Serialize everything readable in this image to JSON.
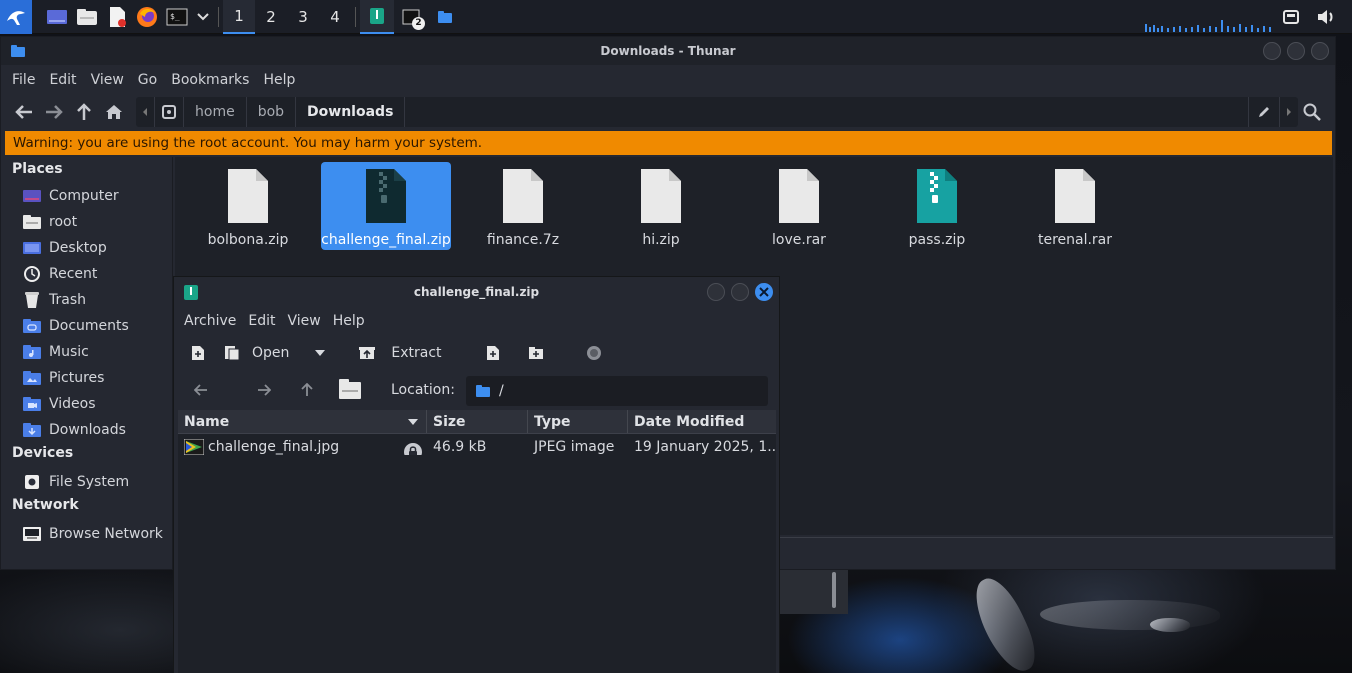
{
  "panel": {
    "workspaces": [
      "1",
      "2",
      "3",
      "4"
    ],
    "terminal_badge": "2"
  },
  "thunar": {
    "title": "Downloads - Thunar",
    "menu": [
      "File",
      "Edit",
      "View",
      "Go",
      "Bookmarks",
      "Help"
    ],
    "path": [
      "home",
      "bob",
      "Downloads"
    ],
    "warning": "Warning: you are using the root account. You may harm your system.",
    "sidebar": {
      "places_label": "Places",
      "places": [
        "Computer",
        "root",
        "Desktop",
        "Recent",
        "Trash",
        "Documents",
        "Music",
        "Pictures",
        "Videos",
        "Downloads"
      ],
      "devices_label": "Devices",
      "devices": [
        "File System"
      ],
      "network_label": "Network",
      "network": [
        "Browse Network"
      ]
    },
    "files": [
      {
        "name": "bolbona.zip",
        "icon": "document-icon"
      },
      {
        "name": "challenge_final.zip",
        "icon": "zip-archive-icon",
        "selected": true
      },
      {
        "name": "finance.7z",
        "icon": "document-icon"
      },
      {
        "name": "hi.zip",
        "icon": "document-icon"
      },
      {
        "name": "love.rar",
        "icon": "document-icon"
      },
      {
        "name": "pass.zip",
        "icon": "zip-archive-icon"
      },
      {
        "name": "terenal.rar",
        "icon": "document-icon"
      }
    ]
  },
  "archive": {
    "title": "challenge_final.zip",
    "menu": [
      "Archive",
      "Edit",
      "View",
      "Help"
    ],
    "open_label": "Open",
    "extract_label": "Extract",
    "location_label": "Location:",
    "location_value": "/",
    "columns": [
      "Name",
      "Size",
      "Type",
      "Date Modified"
    ],
    "rows": [
      {
        "name": "challenge_final.jpg",
        "size": "46.9 kB",
        "type": "JPEG image",
        "date": "19 January 2025, 1..."
      }
    ]
  },
  "colors": {
    "accent": "#3d8ef0",
    "warning": "#f08a00",
    "teal_zip": "#17a2a2"
  }
}
